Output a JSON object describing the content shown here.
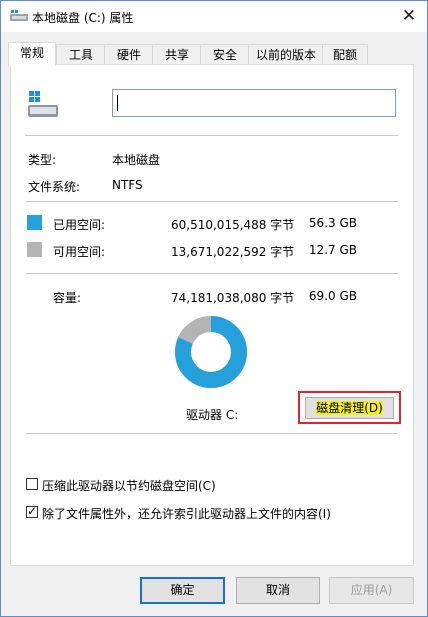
{
  "window": {
    "title": "本地磁盘 (C:) 属性",
    "close": "✕"
  },
  "tabs": [
    {
      "label": "常规"
    },
    {
      "label": "工具"
    },
    {
      "label": "硬件"
    },
    {
      "label": "共享"
    },
    {
      "label": "安全"
    },
    {
      "label": "以前的版本"
    },
    {
      "label": "配额"
    }
  ],
  "general": {
    "name_value": "",
    "type_label": "类型:",
    "type_value": "本地磁盘",
    "fs_label": "文件系统:",
    "fs_value": "NTFS",
    "used_label": "已用空间:",
    "used_bytes": "60,510,015,488 字节",
    "used_gb": "56.3 GB",
    "free_label": "可用空间:",
    "free_bytes": "13,671,022,592 字节",
    "free_gb": "12.7 GB",
    "capacity_label": "容量:",
    "capacity_bytes": "74,181,038,080 字节",
    "capacity_gb": "69.0 GB",
    "drive_label": "驱动器 C:",
    "cleanup_text": "磁盘清理",
    "cleanup_key": "(D)",
    "compress_label": "压缩此驱动器以节约磁盘空间(C)",
    "index_label": "除了文件属性外，还允许索引此驱动器上文件的内容(I)",
    "used_fraction": 0.8157,
    "used_color": "#26a0da",
    "free_color": "#b4b4b4"
  },
  "buttons": {
    "ok": "确定",
    "cancel": "取消",
    "apply": "应用(A)"
  }
}
